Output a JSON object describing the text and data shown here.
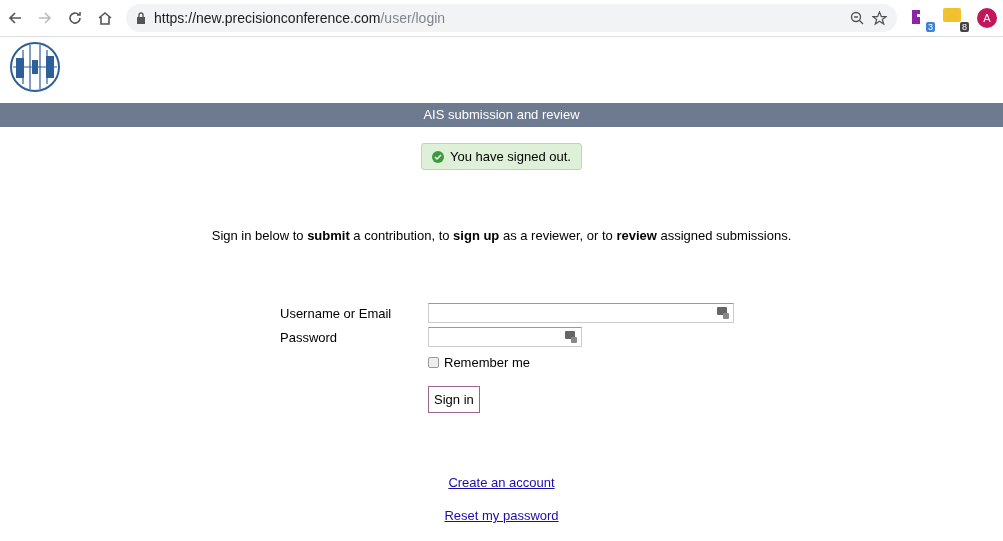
{
  "browser": {
    "url_host": "https://new.precisionconference.com",
    "url_path": "/user/login",
    "extensions": [
      {
        "kind": "puzzle",
        "badge": "3",
        "color": "#3b82d9"
      },
      {
        "kind": "password",
        "badge": "8",
        "color": "#444444"
      }
    ],
    "avatar": "A"
  },
  "banner": {
    "title": "AIS submission and review"
  },
  "alert": {
    "text": "You have signed out."
  },
  "intro": "Sign in below to **submit** a contribution, to **sign up** as a reviewer, or to **review** assigned submissions.",
  "form": {
    "fields": [
      {
        "label": "Username or Email",
        "kind": "text"
      },
      {
        "label": "Password",
        "kind": "password"
      }
    ],
    "remember": {
      "label": "Remember me",
      "checked": false
    },
    "submit": "Sign in"
  },
  "links": [
    "Create an account",
    "Reset my password"
  ]
}
